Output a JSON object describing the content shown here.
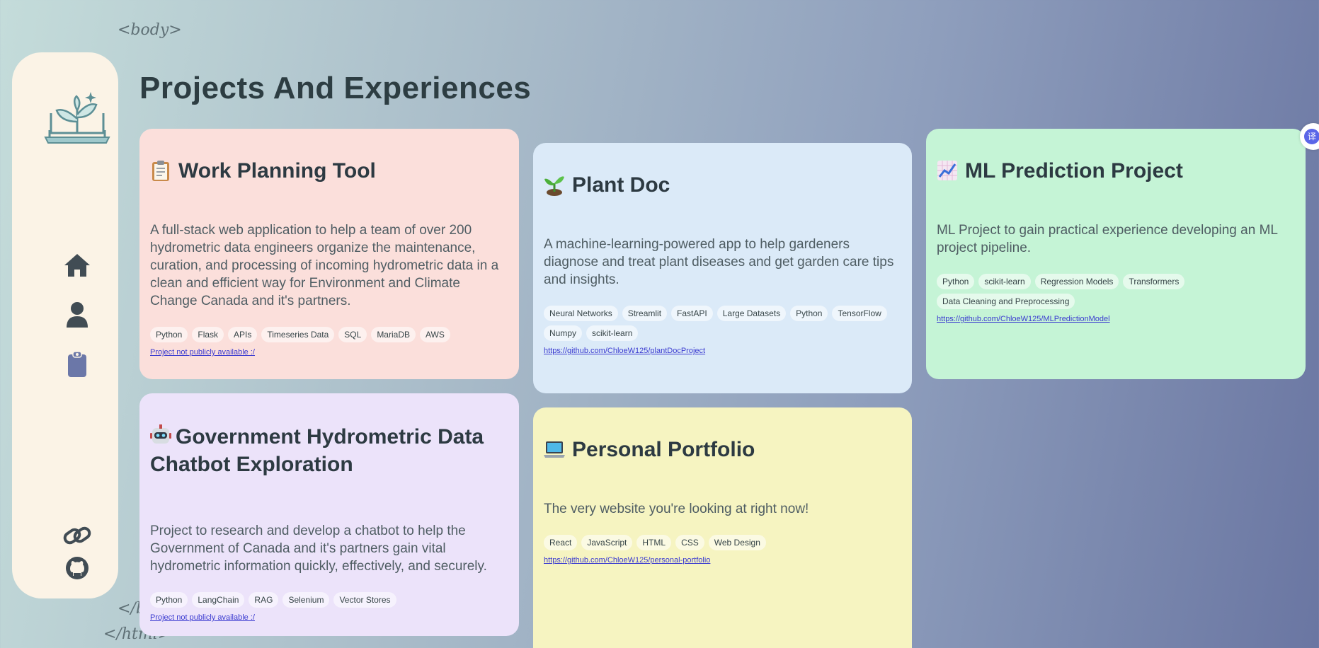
{
  "decor": {
    "body_open": "<body>",
    "body_close": "</body>",
    "html_close": "</html>"
  },
  "sidebar": {
    "logo_icon": "plant-laptop-icon",
    "nav": [
      {
        "icon": "home-icon"
      },
      {
        "icon": "person-icon"
      },
      {
        "icon": "clipboard-icon"
      }
    ],
    "bottom": [
      {
        "icon": "link-icon"
      },
      {
        "icon": "github-icon"
      }
    ]
  },
  "page": {
    "title": "Projects And Experiences"
  },
  "projects": [
    {
      "emoji": "clipboard-emoji",
      "title": "Work Planning Tool",
      "description": "A full-stack web application to help a team of over 200 hydrometric data engineers organize the maintenance, curation, and processing of incoming hydrometric data in a clean and efficient way for Environment and Climate Change Canada and it's partners.",
      "tags": [
        "Python",
        "Flask",
        "APIs",
        "Timeseries Data",
        "SQL",
        "MariaDB",
        "AWS"
      ],
      "link": "Project not publicly available :/"
    },
    {
      "emoji": "seedling-emoji",
      "title": "Plant Doc",
      "description": "A machine-learning-powered app to help gardeners diagnose and treat plant diseases and get garden care tips and insights.",
      "tags": [
        "Neural Networks",
        "Streamlit",
        "FastAPI",
        "Large Datasets",
        "Python",
        "TensorFlow",
        "Numpy",
        "scikit-learn"
      ],
      "link": "https://github.com/ChloeW125/plantDocProject"
    },
    {
      "emoji": "chart-increasing-emoji",
      "title": "ML Prediction Project",
      "description": "ML Project to gain practical experience developing an ML project pipeline.",
      "tags": [
        "Python",
        "scikit-learn",
        "Regression Models",
        "Transformers",
        "Data Cleaning and Preprocessing"
      ],
      "link": "https://github.com/ChloeW125/MLPredictionModel"
    },
    {
      "emoji": "robot-emoji",
      "title": "Government Hydrometric Data Chatbot Exploration",
      "description": "Project to research and develop a chatbot to help the Government of Canada and it's partners gain vital hydrometric information quickly, effectively, and securely.",
      "tags": [
        "Python",
        "LangChain",
        "RAG",
        "Selenium",
        "Vector Stores"
      ],
      "link": "Project not publicly available :/"
    },
    {
      "emoji": "laptop-emoji",
      "title": "Personal Portfolio",
      "description": "The very website you're looking at right now!",
      "tags": [
        "React",
        "JavaScript",
        "HTML",
        "CSS",
        "Web Design"
      ],
      "link": "https://github.com/ChloeW125/personal-portfolio"
    }
  ],
  "translate_badge": {
    "label": "译",
    "icon": "translate-icon"
  },
  "colors": {
    "sidebar_bg": "#fbf3e6",
    "card_work": "#fbdfdb",
    "card_plant": "#dbeaf8",
    "card_ml": "#c5f4d6",
    "card_gov": "#ece3fa",
    "card_portfolio": "#f6f4c1",
    "icon_dark": "#414c54",
    "icon_clipboard": "#6b77a8"
  }
}
